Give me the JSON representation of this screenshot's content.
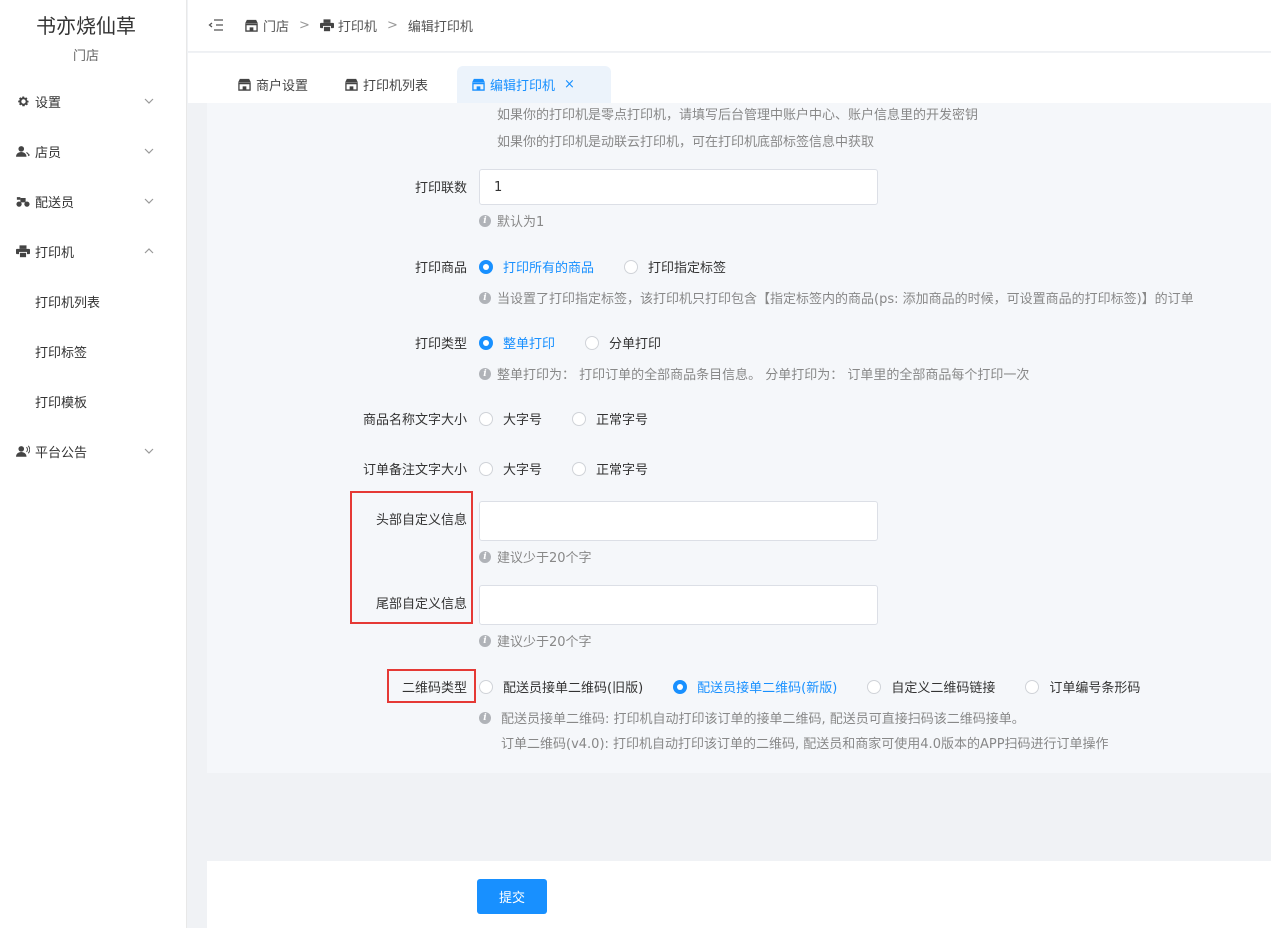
{
  "brand": {
    "name": "书亦烧仙草",
    "sub": "门店"
  },
  "sidebar": {
    "items": [
      {
        "label": "设置"
      },
      {
        "label": "店员"
      },
      {
        "label": "配送员"
      },
      {
        "label": "打印机"
      },
      {
        "label": "平台公告"
      }
    ],
    "printer_sub": [
      {
        "label": "打印机列表"
      },
      {
        "label": "打印标签"
      },
      {
        "label": "打印模板"
      }
    ]
  },
  "breadcrumb": {
    "store": "门店",
    "printer": "打印机",
    "edit": "编辑打印机",
    "sep": ">"
  },
  "tabs": [
    {
      "label": "商户设置"
    },
    {
      "label": "打印机列表"
    },
    {
      "label": "编辑打印机",
      "close": "×"
    }
  ],
  "form": {
    "top_hint_1": "如果你的打印机是零点打印机，请填写后台管理中账户中心、账户信息里的开发密钥",
    "top_hint_2": "如果你的打印机是动联云打印机，可在打印机底部标签信息中获取",
    "copies": {
      "label": "打印联数",
      "value": "1",
      "hint": "默认为1"
    },
    "print_goods": {
      "label": "打印商品",
      "options": [
        "打印所有的商品",
        "打印指定标签"
      ],
      "selected": 0,
      "hint": "当设置了打印指定标签，该打印机只打印包含【指定标签内的商品(ps: 添加商品的时候，可设置商品的打印标签)】的订单"
    },
    "print_type": {
      "label": "打印类型",
      "options": [
        "整单打印",
        "分单打印"
      ],
      "selected": 0,
      "hint": "整单打印为： 打印订单的全部商品条目信息。 分单打印为： 订单里的全部商品每个打印一次"
    },
    "goods_font": {
      "label": "商品名称文字大小",
      "options": [
        "大字号",
        "正常字号"
      ]
    },
    "remark_font": {
      "label": "订单备注文字大小",
      "options": [
        "大字号",
        "正常字号"
      ]
    },
    "header_info": {
      "label": "头部自定义信息",
      "value": "",
      "hint": "建议少于20个字"
    },
    "footer_info": {
      "label": "尾部自定义信息",
      "value": "",
      "hint": "建议少于20个字"
    },
    "qrcode": {
      "label": "二维码类型",
      "options": [
        "配送员接单二维码(旧版)",
        "配送员接单二维码(新版)",
        "自定义二维码链接",
        "订单编号条形码"
      ],
      "selected": 1,
      "hint_1": "配送员接单二维码: 打印机自动打印该订单的接单二维码, 配送员可直接扫码该二维码接单。",
      "hint_2": "订单二维码(v4.0): 打印机自动打印该订单的二维码, 配送员和商家可使用4.0版本的APP扫码进行订单操作"
    },
    "submit": "提交"
  },
  "colors": {
    "primary": "#1890ff",
    "highlight": "#e53935"
  }
}
